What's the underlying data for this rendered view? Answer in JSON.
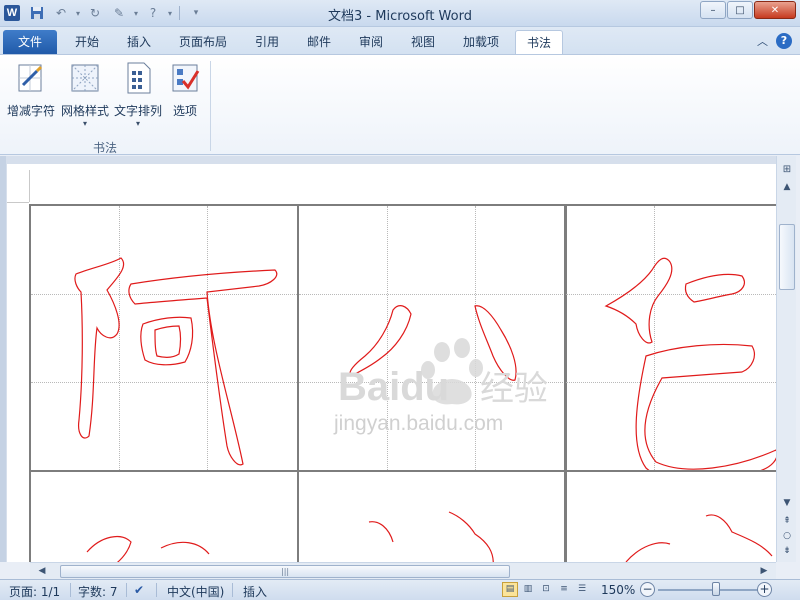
{
  "titlebar": {
    "title": "文档3  -  Microsoft Word",
    "app_icon": "W",
    "window_buttons": {
      "minimize": "–",
      "maximize": "□",
      "close": "✕"
    }
  },
  "tabs": [
    {
      "label": "文件"
    },
    {
      "label": "开始"
    },
    {
      "label": "插入"
    },
    {
      "label": "页面布局"
    },
    {
      "label": "引用"
    },
    {
      "label": "邮件"
    },
    {
      "label": "审阅"
    },
    {
      "label": "视图"
    },
    {
      "label": "加载项"
    },
    {
      "label": "书法"
    }
  ],
  "ribbon": {
    "group_label": "书法",
    "buttons": [
      {
        "label": "增减字符",
        "icon": "character-grid-icon"
      },
      {
        "label": "网格样式",
        "icon": "grid-style-icon",
        "dropdown": true
      },
      {
        "label": "文字排列",
        "icon": "text-arrange-icon",
        "dropdown": true
      },
      {
        "label": "选项",
        "icon": "options-icon"
      }
    ]
  },
  "document": {
    "characters": [
      "阿",
      "八",
      "芭",
      "…",
      "…",
      "…"
    ]
  },
  "watermark": {
    "brand": "Baidu",
    "product": "经验",
    "url": "jingyan.baidu.com"
  },
  "status": {
    "page": "页面: 1/1",
    "words": "字数: 7",
    "language": "中文(中国)",
    "mode": "插入",
    "zoom": "150%",
    "zoom_fraction": 0.58
  }
}
